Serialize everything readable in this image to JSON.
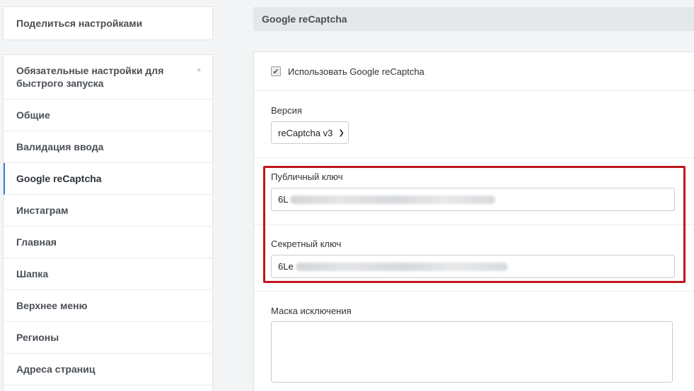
{
  "sidebar": {
    "share_label": "Поделиться настройками",
    "items": [
      {
        "label": "Обязательные настройки для быстрого запуска",
        "starred": true
      },
      {
        "label": "Общие"
      },
      {
        "label": "Валидация ввода"
      },
      {
        "label": "Google reCaptcha",
        "active": true
      },
      {
        "label": "Инстаграм"
      },
      {
        "label": "Главная"
      },
      {
        "label": "Шапка"
      },
      {
        "label": "Верхнее меню"
      },
      {
        "label": "Регионы"
      },
      {
        "label": "Адреса страниц"
      }
    ],
    "star_glyph": "*"
  },
  "main": {
    "section_title": "Google reCaptcha",
    "use_recaptcha": {
      "label": "Использовать Google reCaptcha",
      "checked": true
    },
    "version": {
      "label": "Версия",
      "value": "reCaptcha v3"
    },
    "public_key": {
      "label": "Публичный ключ",
      "value_visible": "6L"
    },
    "secret_key": {
      "label": "Секретный ключ",
      "value_visible": "6Le"
    },
    "exclusion_mask": {
      "label": "Маска исключения",
      "value": ""
    }
  },
  "colors": {
    "highlight": "#c0161c",
    "active_accent": "#3a7bd5",
    "background": "#f2f4f5"
  }
}
